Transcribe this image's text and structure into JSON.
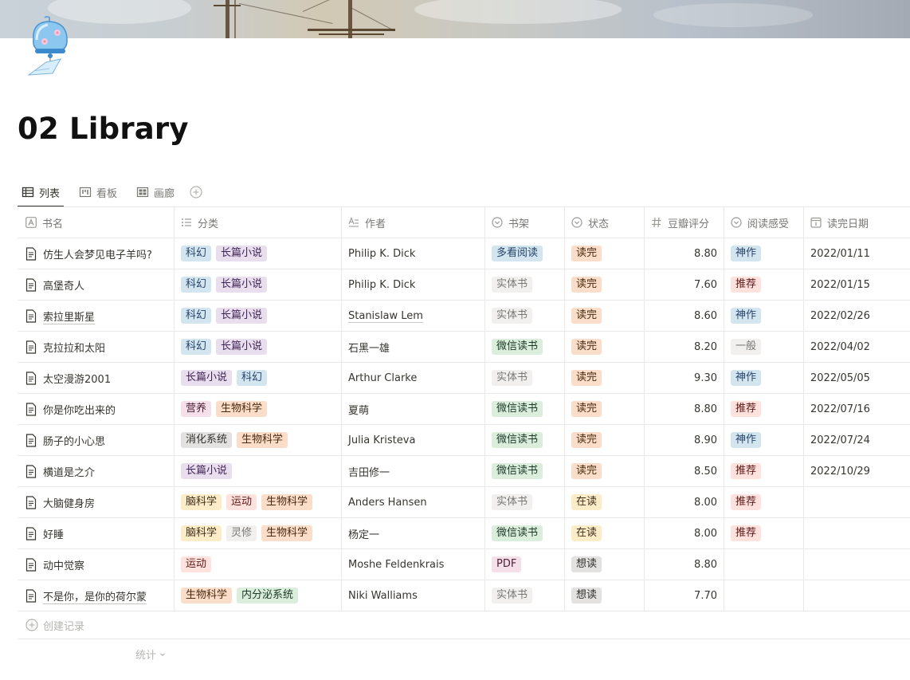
{
  "page": {
    "title": "02 Library"
  },
  "views": [
    {
      "label": "列表",
      "icon": "table-icon",
      "active": true
    },
    {
      "label": "看板",
      "icon": "board-icon",
      "active": false
    },
    {
      "label": "画廊",
      "icon": "gallery-icon",
      "active": false
    }
  ],
  "columns": {
    "name": "书名",
    "category": "分类",
    "author": "作者",
    "shelf": "书架",
    "status": "状态",
    "score": "豆瓣评分",
    "feeling": "阅读感受",
    "date": "读完日期"
  },
  "rows": [
    {
      "name": "仿生人会梦见电子羊吗?",
      "underline": false,
      "categories": [
        {
          "t": "科幻",
          "c": "blue"
        },
        {
          "t": "长篇小说",
          "c": "purple"
        }
      ],
      "author": "Philip K. Dick",
      "author_ul": false,
      "shelf": {
        "t": "多看阅读",
        "c": "blue"
      },
      "status": {
        "t": "读完",
        "c": "orange"
      },
      "score": "8.80",
      "feeling": {
        "t": "神作",
        "c": "blue"
      },
      "date": "2022/01/11"
    },
    {
      "name": "高堡奇人",
      "underline": false,
      "categories": [
        {
          "t": "科幻",
          "c": "blue"
        },
        {
          "t": "长篇小说",
          "c": "purple"
        }
      ],
      "author": "Philip K. Dick",
      "author_ul": false,
      "shelf": {
        "t": "实体书",
        "c": "lgray"
      },
      "status": {
        "t": "读完",
        "c": "orange"
      },
      "score": "7.60",
      "feeling": {
        "t": "推荐",
        "c": "red"
      },
      "date": "2022/01/15"
    },
    {
      "name": "索拉里斯星",
      "underline": true,
      "categories": [
        {
          "t": "科幻",
          "c": "blue"
        },
        {
          "t": "长篇小说",
          "c": "purple"
        }
      ],
      "author": "Stanislaw Lem",
      "author_ul": true,
      "shelf": {
        "t": "实体书",
        "c": "lgray"
      },
      "status": {
        "t": "读完",
        "c": "orange"
      },
      "score": "8.60",
      "feeling": {
        "t": "神作",
        "c": "blue"
      },
      "date": "2022/02/26"
    },
    {
      "name": "克拉拉和太阳",
      "underline": false,
      "categories": [
        {
          "t": "科幻",
          "c": "blue"
        },
        {
          "t": "长篇小说",
          "c": "purple"
        }
      ],
      "author": "石黑一雄",
      "author_ul": false,
      "shelf": {
        "t": "微信读书",
        "c": "green"
      },
      "status": {
        "t": "读完",
        "c": "orange"
      },
      "score": "8.20",
      "feeling": {
        "t": "一般",
        "c": "lgray"
      },
      "date": "2022/04/02"
    },
    {
      "name": "太空漫游2001",
      "underline": false,
      "categories": [
        {
          "t": "长篇小说",
          "c": "purple"
        },
        {
          "t": "科幻",
          "c": "blue"
        }
      ],
      "author": "Arthur Clarke",
      "author_ul": false,
      "shelf": {
        "t": "实体书",
        "c": "lgray"
      },
      "status": {
        "t": "读完",
        "c": "orange"
      },
      "score": "9.30",
      "feeling": {
        "t": "神作",
        "c": "blue"
      },
      "date": "2022/05/05"
    },
    {
      "name": "你是你吃出来的",
      "underline": false,
      "categories": [
        {
          "t": "营养",
          "c": "pink"
        },
        {
          "t": "生物科学",
          "c": "orange"
        }
      ],
      "author": "夏萌",
      "author_ul": false,
      "shelf": {
        "t": "微信读书",
        "c": "green"
      },
      "status": {
        "t": "读完",
        "c": "orange"
      },
      "score": "8.80",
      "feeling": {
        "t": "推荐",
        "c": "red"
      },
      "date": "2022/07/16"
    },
    {
      "name": "肠子的小心思",
      "underline": false,
      "categories": [
        {
          "t": "消化系统",
          "c": "gray"
        },
        {
          "t": "生物科学",
          "c": "orange"
        }
      ],
      "author": "Julia Kristeva",
      "author_ul": false,
      "shelf": {
        "t": "微信读书",
        "c": "green"
      },
      "status": {
        "t": "读完",
        "c": "orange"
      },
      "score": "8.90",
      "feeling": {
        "t": "神作",
        "c": "blue"
      },
      "date": "2022/07/24"
    },
    {
      "name": "横道是之介",
      "underline": false,
      "categories": [
        {
          "t": "长篇小说",
          "c": "purple"
        }
      ],
      "author": "吉田修一",
      "author_ul": false,
      "shelf": {
        "t": "微信读书",
        "c": "green"
      },
      "status": {
        "t": "读完",
        "c": "orange"
      },
      "score": "8.50",
      "feeling": {
        "t": "推荐",
        "c": "red"
      },
      "date": "2022/10/29"
    },
    {
      "name": "大脑健身房",
      "underline": false,
      "categories": [
        {
          "t": "脑科学",
          "c": "yellow"
        },
        {
          "t": "运动",
          "c": "red"
        },
        {
          "t": "生物科学",
          "c": "orange"
        }
      ],
      "author": "Anders Hansen",
      "author_ul": false,
      "shelf": {
        "t": "实体书",
        "c": "lgray"
      },
      "status": {
        "t": "在读",
        "c": "yellow"
      },
      "score": "8.00",
      "feeling": {
        "t": "推荐",
        "c": "red"
      },
      "date": ""
    },
    {
      "name": "好睡",
      "underline": false,
      "categories": [
        {
          "t": "脑科学",
          "c": "yellow"
        },
        {
          "t": "灵修",
          "c": "lgray"
        },
        {
          "t": "生物科学",
          "c": "orange"
        }
      ],
      "author": "杨定一",
      "author_ul": false,
      "shelf": {
        "t": "微信读书",
        "c": "green"
      },
      "status": {
        "t": "在读",
        "c": "yellow"
      },
      "score": "8.00",
      "feeling": {
        "t": "推荐",
        "c": "red"
      },
      "date": ""
    },
    {
      "name": "动中觉察",
      "underline": false,
      "categories": [
        {
          "t": "运动",
          "c": "red"
        }
      ],
      "author": "Moshe Feldenkrais",
      "author_ul": false,
      "shelf": {
        "t": "PDF",
        "c": "pink"
      },
      "status": {
        "t": "想读",
        "c": "gray"
      },
      "score": "8.80",
      "feeling": null,
      "date": ""
    },
    {
      "name": "不是你，是你的荷尔蒙",
      "underline": true,
      "categories": [
        {
          "t": "生物科学",
          "c": "orange"
        },
        {
          "t": "内分泌系统",
          "c": "green"
        }
      ],
      "author": "Niki Walliams",
      "author_ul": false,
      "shelf": {
        "t": "实体书",
        "c": "lgray"
      },
      "status": {
        "t": "想读",
        "c": "gray"
      },
      "score": "7.70",
      "feeling": null,
      "date": ""
    }
  ],
  "footer": {
    "new_record": "创建记录",
    "stats": "统计"
  }
}
